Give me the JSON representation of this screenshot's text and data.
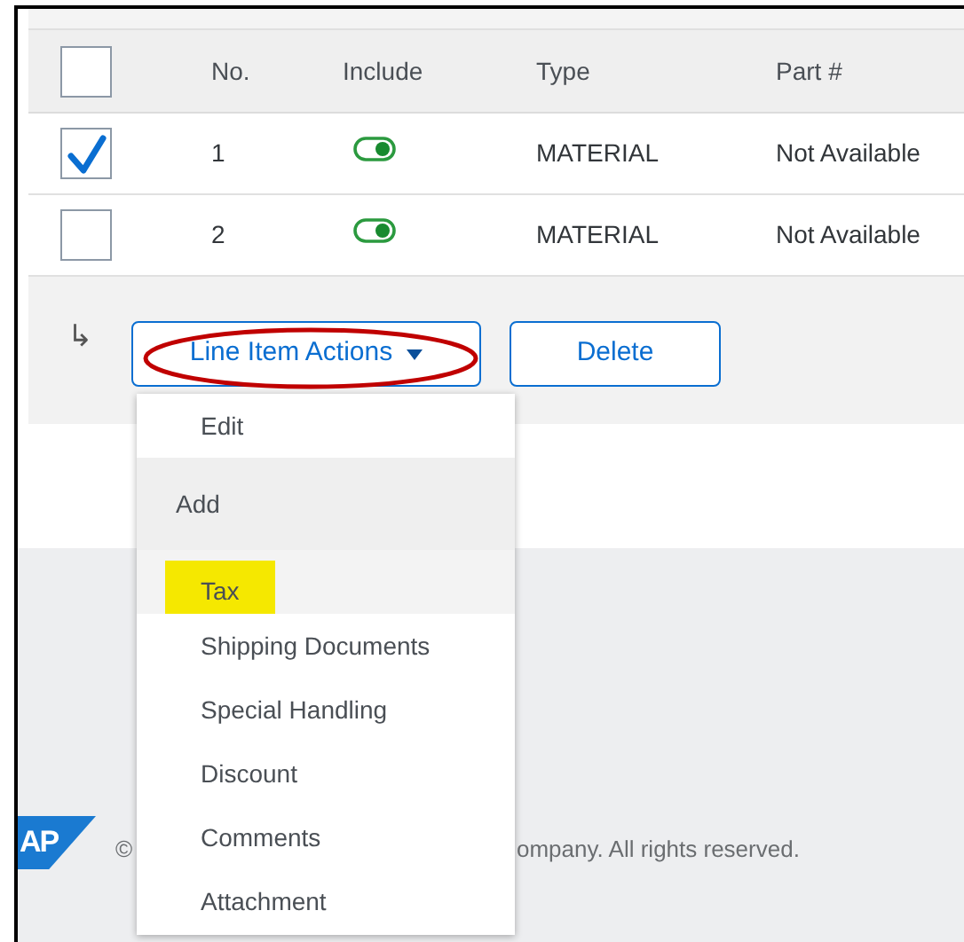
{
  "table": {
    "select_all": {
      "checked": false
    },
    "columns": [
      "No.",
      "Include",
      "Type",
      "Part #"
    ],
    "rows": [
      {
        "selected": true,
        "no": "1",
        "include": {
          "on": true
        },
        "type": "MATERIAL",
        "part": "Not Available"
      },
      {
        "selected": false,
        "no": "2",
        "include": {
          "on": true
        },
        "type": "MATERIAL",
        "part": "Not Available"
      }
    ]
  },
  "actions": {
    "indent_symbol": "↳",
    "buttons": [
      {
        "label": "Line Item Actions",
        "kind": "menu",
        "annotated": true
      },
      {
        "label": "Delete",
        "kind": "plain",
        "annotated": false
      }
    ]
  },
  "menu": {
    "items": [
      {
        "label": "Edit",
        "kind": "action",
        "highlighted": false
      },
      {
        "label": "Add",
        "kind": "header",
        "highlighted": false
      },
      {
        "label": "Tax",
        "kind": "action",
        "highlighted": true
      },
      {
        "label": "Shipping Documents",
        "kind": "action",
        "highlighted": false
      },
      {
        "label": "Special Handling",
        "kind": "action",
        "highlighted": false
      },
      {
        "label": "Discount",
        "kind": "action",
        "highlighted": false
      },
      {
        "label": "Comments",
        "kind": "action",
        "highlighted": false
      },
      {
        "label": "Attachment",
        "kind": "action",
        "highlighted": false
      }
    ]
  },
  "footer": {
    "logo": "AP",
    "copyright_start": "©",
    "copyright_end": "ompany. All rights reserved."
  }
}
